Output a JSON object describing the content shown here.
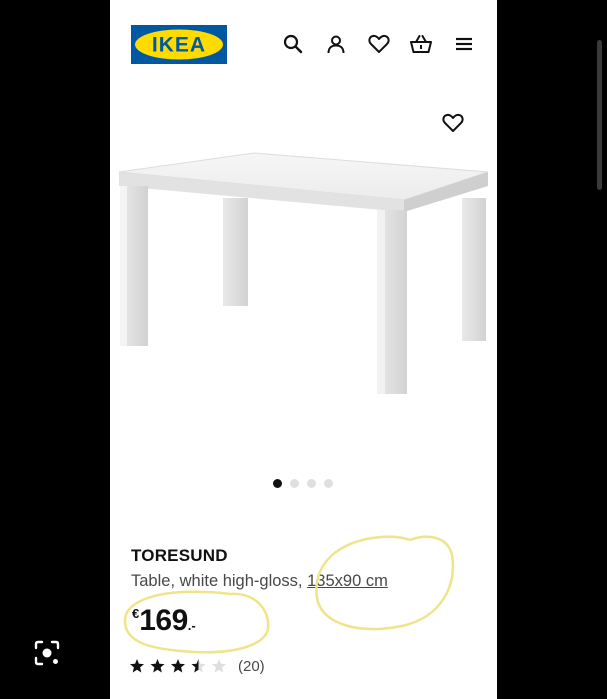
{
  "brand": {
    "logo_text": "IKEA",
    "blue": "#0058a3",
    "yellow": "#ffdb00"
  },
  "header": {
    "icons": [
      "search-icon",
      "account-icon",
      "wishlist-icon",
      "cart-icon",
      "menu-icon"
    ]
  },
  "gallery": {
    "image": "white high-gloss table",
    "total_images": 4,
    "active_index": 0
  },
  "product": {
    "name": "TORESUND",
    "description_prefix": "Table, white high-gloss, ",
    "size": "135x90 cm",
    "price": {
      "currency": "€",
      "integer": "169",
      "decimal": ".-"
    },
    "rating": {
      "stars_value": 3.5,
      "stars_max": 5,
      "count": "(20)"
    }
  },
  "colors": {
    "text_primary": "#111111",
    "text_secondary": "#484848",
    "annotation": "#efe48a"
  }
}
